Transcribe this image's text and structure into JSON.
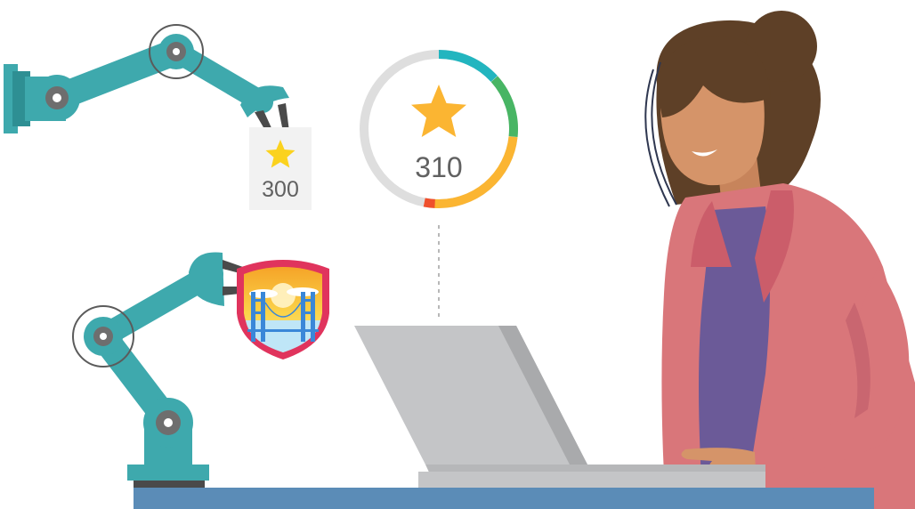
{
  "card": {
    "points": "300"
  },
  "gauge": {
    "points": "310"
  },
  "colors": {
    "robot_teal": "#3ea9ad",
    "robot_teal_dark": "#2e8f93",
    "robot_gray": "#5b5b5b",
    "star": "#fbb532",
    "gauge_track": "#dedede",
    "gauge_teal": "#22b5bf",
    "gauge_green": "#48b564",
    "gauge_yellow": "#fbb532",
    "gauge_red": "#ef4f2c",
    "laptop": "#c4c5c7",
    "desk": "#5b8cb7",
    "hair": "#5e4027",
    "skin": "#d59469",
    "jacket": "#d9767a",
    "shirt": "#6b5a98"
  },
  "icons": [
    "robot-arm-icon",
    "star-icon",
    "badge-shield-icon",
    "laptop-icon"
  ]
}
